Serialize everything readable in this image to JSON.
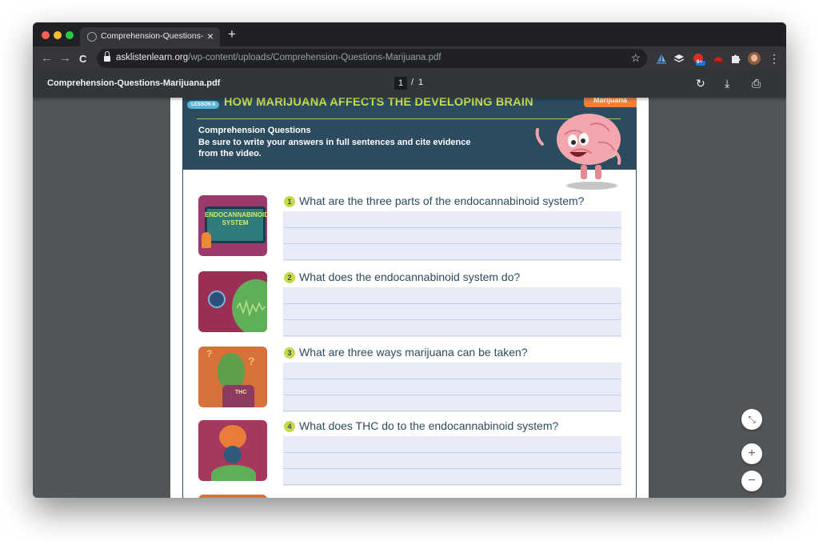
{
  "tab": {
    "title": "Comprehension-Questions-Ma",
    "close_icon": "×",
    "new_tab_icon": "+"
  },
  "toolbar": {
    "back_icon": "←",
    "forward_icon": "→",
    "reload_icon": "C",
    "url_domain": "asklistenlearn.org",
    "url_path": "/wp-content/uploads/Comprehension-Questions-Marijuana.pdf",
    "bookmark_icon": "☆",
    "ext_badge": "9+",
    "menu_icon": "⋮"
  },
  "pdf_toolbar": {
    "filename": "Comprehension-Questions-Marijuana.pdf",
    "current_page": "1",
    "page_separator": "/",
    "total_pages": "1",
    "rotate_icon": "↻",
    "download_icon": "⤓",
    "print_icon": "⎙"
  },
  "document": {
    "lesson_badge": "LESSON 8",
    "title": "HOW MARIJUANA AFFECTS THE DEVELOPING BRAIN",
    "topic_tab": "Marijuana",
    "heading": "Comprehension Questions",
    "instructions": "Be sure to write your answers in full sentences and cite evidence from the video.",
    "questions": [
      {
        "number": "1",
        "text": "What are the three parts of the endocannabinoid system?",
        "thumb_text": "ENDOCANNABINOID SYSTEM"
      },
      {
        "number": "2",
        "text": "What does the endocannabinoid system do?"
      },
      {
        "number": "3",
        "text": "What are three ways marijuana can be taken?",
        "thumb_text": "THC"
      },
      {
        "number": "4",
        "text": "What does THC do to the endocannabinoid system?"
      }
    ]
  },
  "zoom": {
    "fit_icon": "⤡",
    "zoom_in": "+",
    "zoom_out": "−"
  },
  "colors": {
    "banner_bg": "#2c4b5e",
    "banner_title": "#cbdc4a",
    "question_text": "#2c4b5e",
    "answer_bg": "#e8ecf9",
    "topic_tab": "#f07f3c",
    "viewer_bg": "#525659"
  }
}
